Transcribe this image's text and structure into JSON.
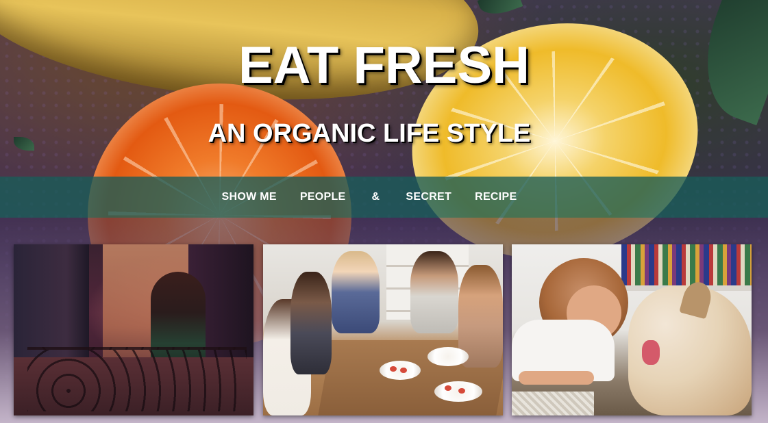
{
  "header": {
    "title": "EAT FRESH",
    "subtitle": "AN ORGANIC LIFE STYLE"
  },
  "nav": {
    "items": [
      {
        "label": "SHOW ME"
      },
      {
        "label": "PEOPLE"
      },
      {
        "label": "&"
      },
      {
        "label": "SECRET"
      },
      {
        "label": "RECIPE"
      }
    ]
  },
  "gallery": {
    "photos": [
      {
        "subject": "woman reading menu at restaurant table"
      },
      {
        "subject": "friends dining together at a table"
      },
      {
        "subject": "girl lying on floor with puppy"
      }
    ]
  },
  "colors": {
    "nav_bar": "#185c58",
    "title_text": "#ffffff",
    "text_shadow": "#000000"
  }
}
